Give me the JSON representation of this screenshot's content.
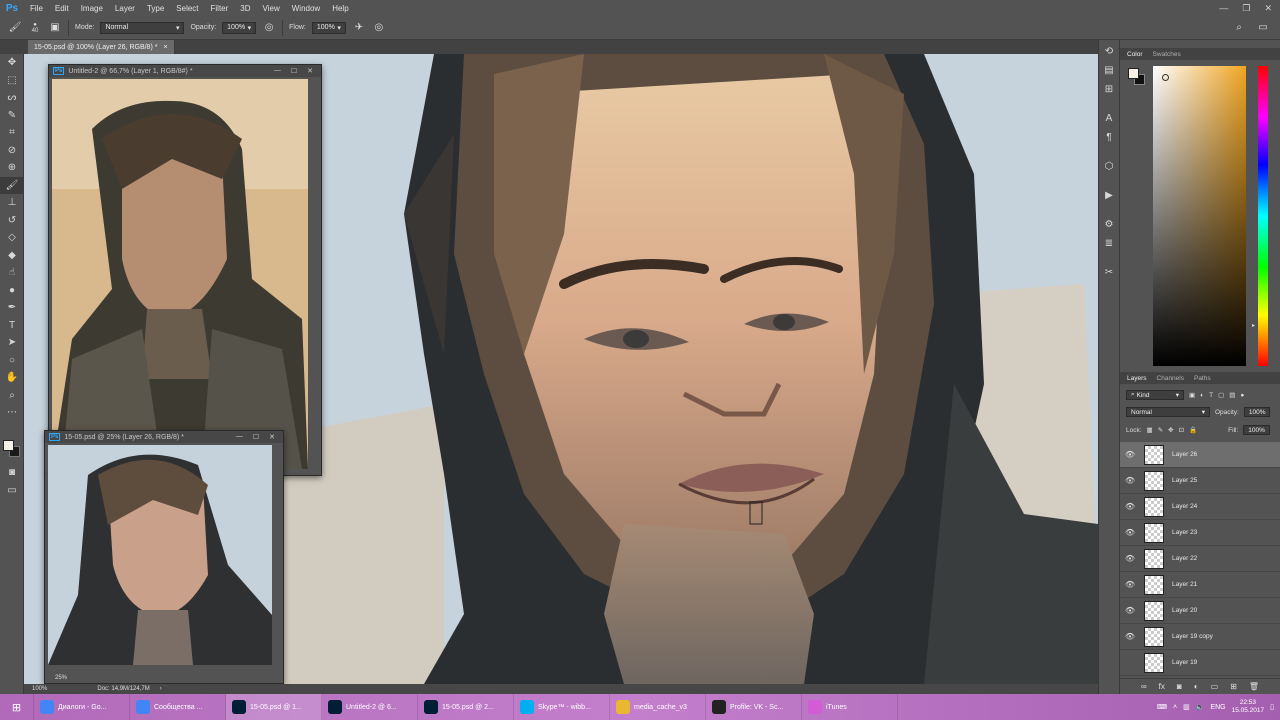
{
  "app": {
    "logo": "Ps"
  },
  "menu": [
    "File",
    "Edit",
    "Image",
    "Layer",
    "Type",
    "Select",
    "Filter",
    "3D",
    "View",
    "Window",
    "Help"
  ],
  "options": {
    "mode_label": "Mode:",
    "mode_value": "Normal",
    "opacity_label": "Opacity:",
    "opacity_value": "100%",
    "flow_label": "Flow:",
    "flow_value": "100%",
    "brush_size": "40"
  },
  "document_tab": {
    "title": "15-05.psd @ 100% (Layer 26, RGB/8) *",
    "close": "×"
  },
  "ref_window": {
    "title": "Untitled-2 @ 66,7% (Layer 1, RGB/8#) *"
  },
  "nav_window": {
    "title": "15-05.psd @ 25% (Layer 26, RGB/8) *",
    "zoom": "25%"
  },
  "status": {
    "zoom": "100%",
    "doc": "Doc: 14,9M/124,7M"
  },
  "color_panel": {
    "tabs": [
      "Color",
      "Swatches"
    ]
  },
  "layers_panel": {
    "tabs": [
      "Layers",
      "Channels",
      "Paths"
    ],
    "kind": "Kind",
    "blend_mode": "Normal",
    "opacity_label": "Opacity:",
    "opacity_value": "100%",
    "lock_label": "Lock:",
    "fill_label": "Fill:",
    "fill_value": "100%",
    "layers": [
      {
        "name": "Layer 26",
        "visible": true,
        "selected": true
      },
      {
        "name": "Layer 25",
        "visible": true,
        "selected": false
      },
      {
        "name": "Layer 24",
        "visible": true,
        "selected": false
      },
      {
        "name": "Layer 23",
        "visible": true,
        "selected": false
      },
      {
        "name": "Layer 22",
        "visible": true,
        "selected": false
      },
      {
        "name": "Layer 21",
        "visible": true,
        "selected": false
      },
      {
        "name": "Layer 20",
        "visible": true,
        "selected": false
      },
      {
        "name": "Layer 19 copy",
        "visible": true,
        "selected": false
      },
      {
        "name": "Layer 19",
        "visible": false,
        "selected": false
      }
    ]
  },
  "taskbar": {
    "items": [
      {
        "label": "Диалоги - Go...",
        "icon": "chrome-icon",
        "color": "#4285f4"
      },
      {
        "label": "Сообщества ...",
        "icon": "chrome-icon",
        "color": "#4285f4"
      },
      {
        "label": "15-05.psd @ 1...",
        "icon": "photoshop-icon",
        "color": "#001e36"
      },
      {
        "label": "Untitled-2 @ 6...",
        "icon": "photoshop-icon",
        "color": "#001e36"
      },
      {
        "label": "15-05.psd @ 2...",
        "icon": "photoshop-icon",
        "color": "#001e36"
      },
      {
        "label": "Skype™ - wibb...",
        "icon": "skype-icon",
        "color": "#00aff0"
      },
      {
        "label": "media_cache_v3",
        "icon": "folder-icon",
        "color": "#e8b830"
      },
      {
        "label": "Profile: VK - Sc...",
        "icon": "obs-icon",
        "color": "#222222"
      },
      {
        "label": "iTunes",
        "icon": "itunes-icon",
        "color": "#d35bd6"
      }
    ],
    "lang": "ENG",
    "time": "22:53",
    "date": "15.05.2017"
  }
}
